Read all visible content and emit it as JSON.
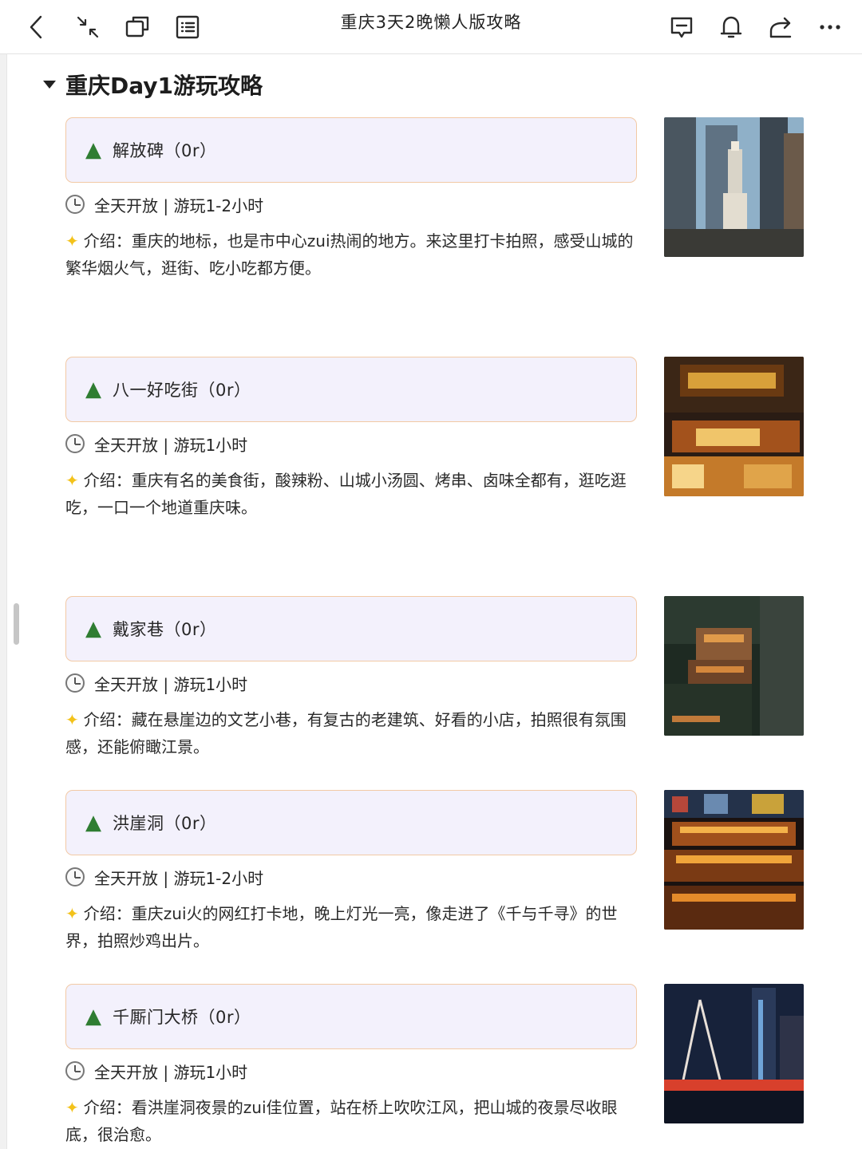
{
  "header": {
    "title": "重庆3天2晚懒人版攻略",
    "icons": [
      "back-icon",
      "collapse-icon",
      "window-icon",
      "outline-icon",
      "comment-icon",
      "bell-icon",
      "share-icon",
      "more-icon"
    ]
  },
  "section": {
    "title": "重庆Day1游玩攻略"
  },
  "spots": [
    {
      "name": "解放碑（0r）",
      "meta": "全天开放 | 游玩1-2小时",
      "intro": "介绍：重庆的地标，也是市中心zui热闹的地方。来这里打卡拍照，感受山城的繁华烟火气，逛街、吃小吃都方便。"
    },
    {
      "name": "八一好吃街（0r）",
      "meta": "全天开放 | 游玩1小时",
      "intro": "介绍：重庆有名的美食街，酸辣粉、山城小汤圆、烤串、卤味全都有，逛吃逛吃，一口一个地道重庆味。"
    },
    {
      "name": "戴家巷（0r）",
      "meta": "全天开放 | 游玩1小时",
      "intro": "介绍：藏在悬崖边的文艺小巷，有复古的老建筑、好看的小店，拍照很有氛围感，还能俯瞰江景。"
    },
    {
      "name": "洪崖洞（0r）",
      "meta": "全天开放 | 游玩1-2小时",
      "intro": "介绍：重庆zui火的网红打卡地，晚上灯光一亮，像走进了《千与千寻》的世界，拍照炒鸡出片。"
    },
    {
      "name": "千厮门大桥（0r）",
      "meta": "全天开放 | 游玩1小时",
      "intro": "介绍：看洪崖洞夜景的zui佳位置，站在桥上吹吹江风，把山城的夜景尽收眼底，很治愈。"
    }
  ],
  "colors": {
    "card_bg": "#f3f1fc",
    "card_border": "#f2c9a5",
    "sparkle": "#f3c21a"
  }
}
